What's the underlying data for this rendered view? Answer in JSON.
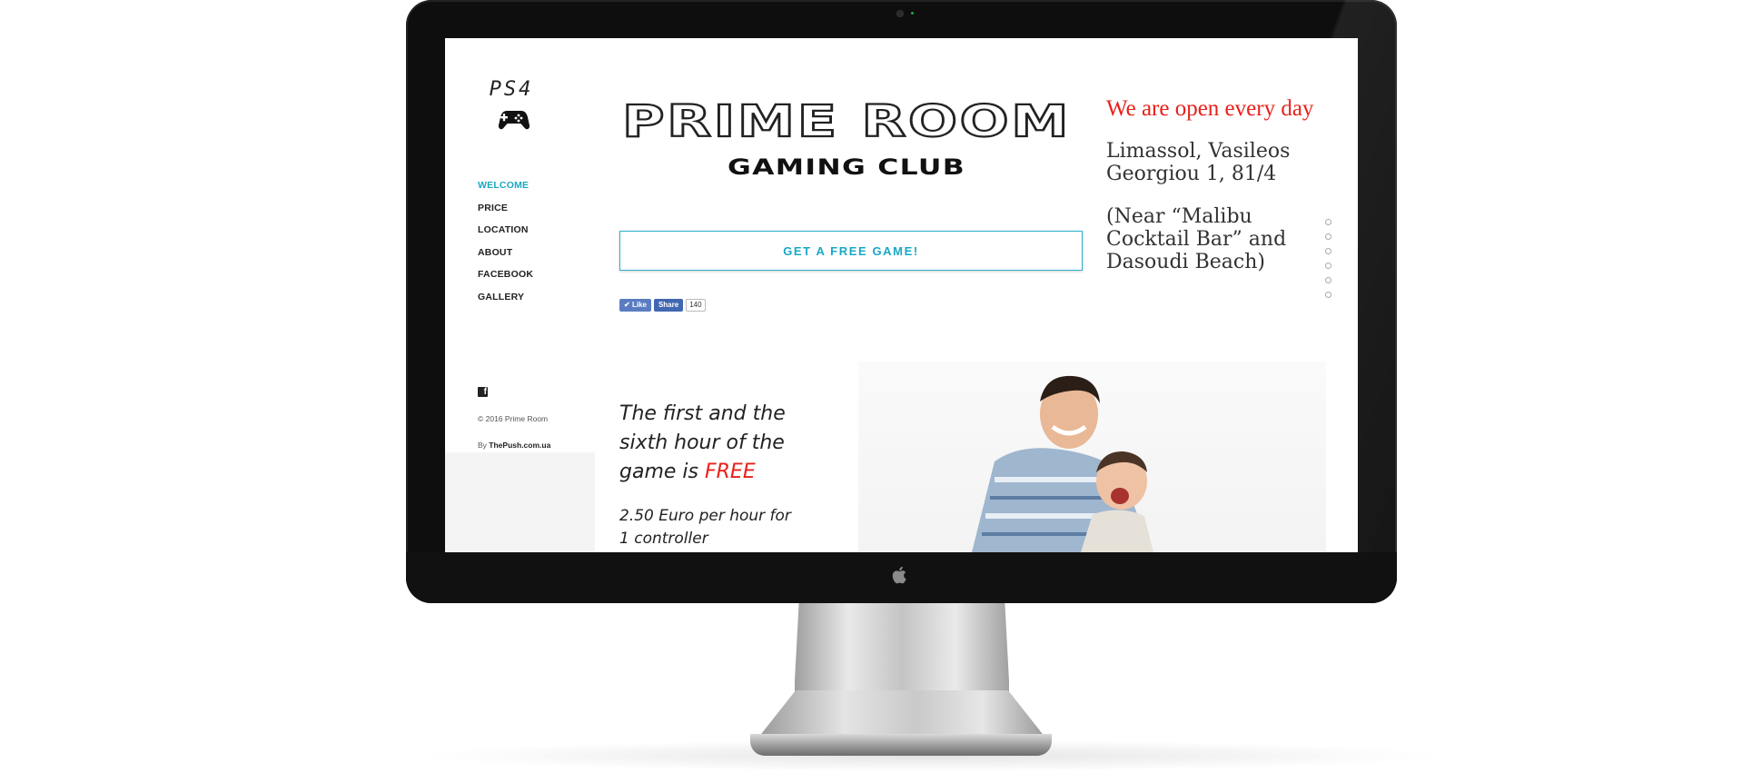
{
  "sidebar": {
    "logo_text": "PS4",
    "nav": [
      "WELCOME",
      "PRICE",
      "LOCATION",
      "ABOUT",
      "FACEBOOK",
      "GALLERY"
    ],
    "active_nav": "WELCOME",
    "copyright": "© 2016 Prime Room",
    "by_prefix": "By",
    "by_link": "ThePush.com.ua"
  },
  "brand": {
    "name": "PRIME ROOM",
    "subtitle": "GAMING CLUB"
  },
  "cta_label": "GET A FREE GAME!",
  "facebook": {
    "like_label": "Like",
    "share_label": "Share",
    "count": "140"
  },
  "info": {
    "open_title": "We are open every day",
    "address": "Limassol, Vasileos Georgiou 1, 81/4",
    "near": "(Near “Malibu Cocktail Bar” and Dasoudi Beach)"
  },
  "promo": {
    "title_main": "The first and the sixth hour of the game is",
    "title_highlight": "FREE",
    "price_line": "2.50 Euro per hour for 1 controller"
  },
  "colors": {
    "accent": "#19a8c4",
    "highlight_red": "#e8201a"
  },
  "icons": [
    "camera-icon",
    "apple-logo-icon",
    "gamepad-icon",
    "facebook-icon",
    "checkmark-icon"
  ]
}
